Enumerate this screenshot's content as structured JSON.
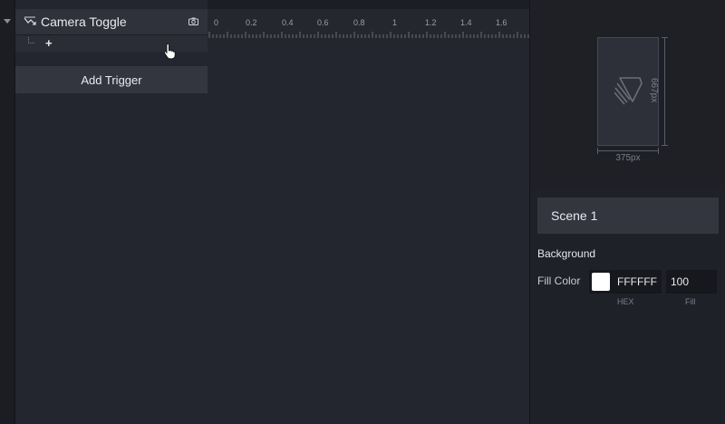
{
  "layer": {
    "name": "Camera Toggle",
    "icon": "trigger-icon",
    "action_icon": "camera-icon"
  },
  "sub_row": {
    "add_symbol": "+"
  },
  "add_trigger_label": "Add Trigger",
  "timeline": {
    "ticks": [
      "0",
      "0.2",
      "0.4",
      "0.6",
      "0.8",
      "1",
      "1.2",
      "1.4",
      "1.6"
    ]
  },
  "preview": {
    "height_label": "667px",
    "width_label": "375px"
  },
  "inspector": {
    "scene_name": "Scene 1",
    "section_title": "Background",
    "fill_color_label": "Fill Color",
    "hex_value": "FFFFFF",
    "fill_value": "100",
    "hex_caption": "HEX",
    "fill_caption": "Fill",
    "swatch_color": "#ffffff"
  }
}
